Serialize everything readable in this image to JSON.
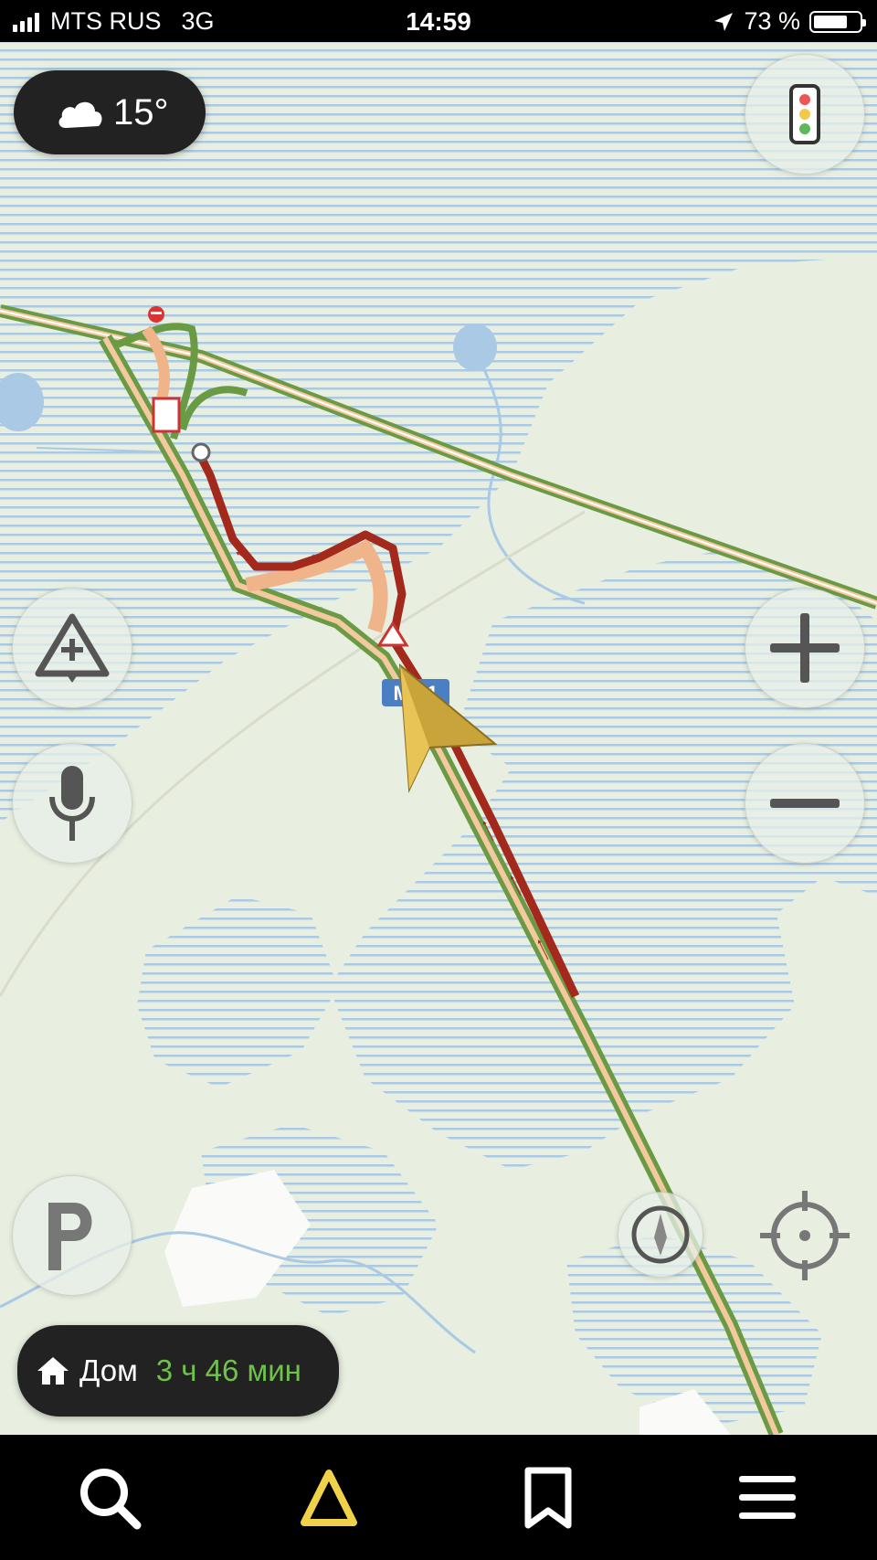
{
  "status_bar": {
    "carrier": "MTS RUS",
    "network": "3G",
    "time": "14:59",
    "battery": "73 %",
    "battery_level": 0.73
  },
  "weather": {
    "temperature": "15°",
    "icon": "cloud-icon"
  },
  "map": {
    "road_label": "M-11",
    "colors": {
      "route_jam": "#a3291c",
      "route_slow": "#f0b48a",
      "road_green": "#6a9a44",
      "water": "#a9c9e4",
      "land": "#e8efe0"
    }
  },
  "controls": {
    "traffic_icon": "traffic-light-icon",
    "add_event_icon": "warning-plus-icon",
    "voice_icon": "microphone-icon",
    "parking_icon": "parking-icon",
    "zoom_in_icon": "plus-icon",
    "zoom_out_icon": "minus-icon",
    "compass_icon": "compass-icon",
    "locate_icon": "target-icon"
  },
  "route": {
    "destination": "Дом",
    "eta": "3 ч 46 мин",
    "icon": "home-icon"
  },
  "tabbar": {
    "items": [
      "search-icon",
      "navigation-icon",
      "bookmark-icon",
      "menu-icon"
    ],
    "active_color": "#f0d24a"
  }
}
